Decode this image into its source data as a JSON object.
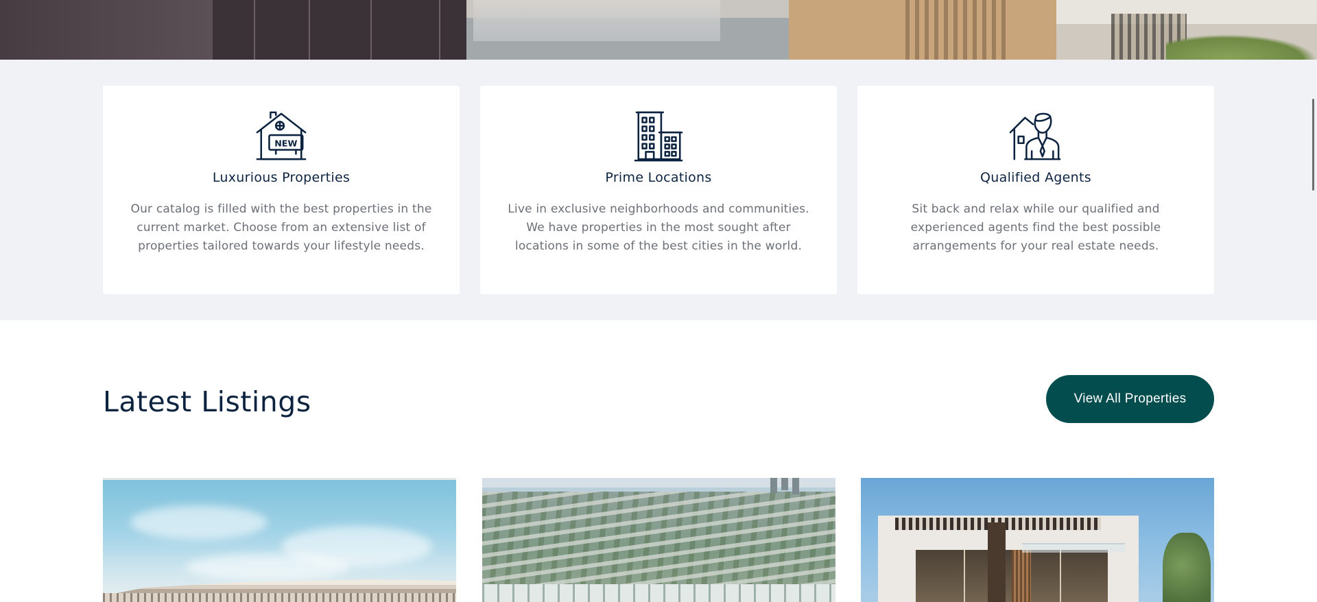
{
  "features": [
    {
      "icon": "new-property-house-icon",
      "icon_text": "NEW",
      "title": "Luxurious Properties",
      "description": "Our catalog is filled with the best properties in the current market. Choose from an extensive list of properties tailored towards your lifestyle needs."
    },
    {
      "icon": "city-buildings-icon",
      "title": "Prime Locations",
      "description": "Live in exclusive neighborhoods and communities. We have properties in the most sought after locations in some of the best cities in the world."
    },
    {
      "icon": "real-estate-agent-icon",
      "title": "Qualified Agents",
      "description": "Sit back and relax while our qualified and experienced agents find the best possible arrangements for your real estate needs."
    }
  ],
  "listings_section": {
    "title": "Latest Listings",
    "cta_label": "View All Properties"
  },
  "colors": {
    "heading_navy": "#0c2340",
    "cta_teal": "#034d4e",
    "band_gray": "#f1f2f5",
    "body_text": "#6b6f77"
  }
}
